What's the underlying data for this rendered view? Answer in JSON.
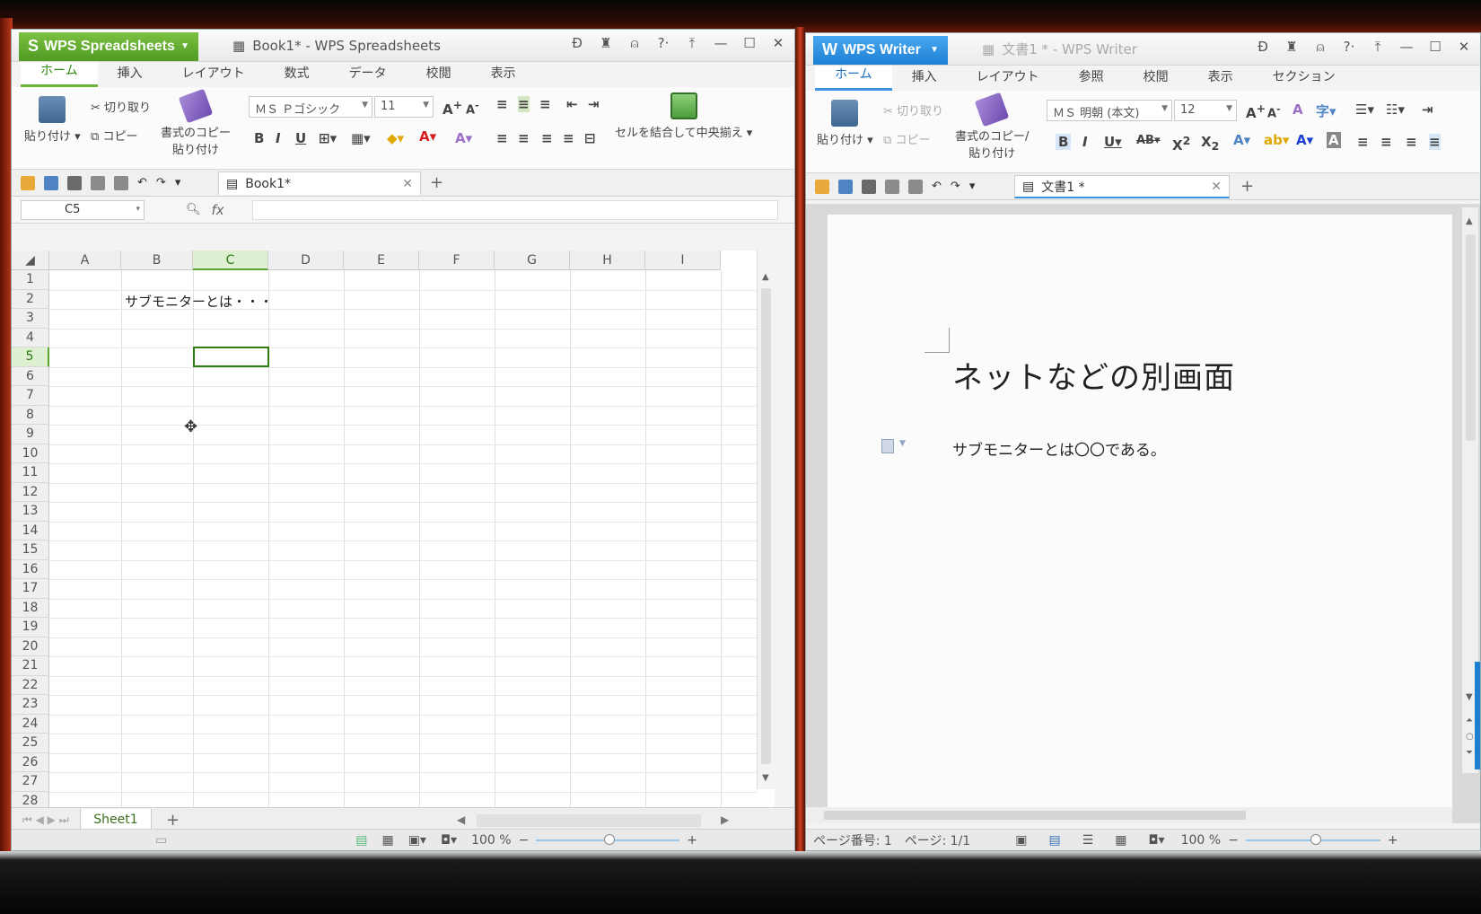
{
  "spreadsheet": {
    "app_name": "WPS Spreadsheets",
    "title": "Book1* - WPS Spreadsheets",
    "tabs": [
      "ホーム",
      "挿入",
      "レイアウト",
      "数式",
      "データ",
      "校閲",
      "表示"
    ],
    "ribbon": {
      "paste": "貼り付け",
      "cut": "切り取り",
      "copy": "コピー",
      "format_painter_line1": "書式のコピー",
      "format_painter_line2": "貼り付け",
      "font_name": "ＭＳ Ｐゴシック",
      "font_size": "11",
      "merge_center": "セルを結合して中央揃え"
    },
    "doc_tab": "Book1*",
    "name_box": "C5",
    "fx_label": "fx",
    "columns": [
      "A",
      "B",
      "C",
      "D",
      "E",
      "F",
      "G",
      "H",
      "I"
    ],
    "selected_column": "C",
    "selected_row": 5,
    "rows": [
      "1",
      "2",
      "3",
      "4",
      "5",
      "6",
      "7",
      "8",
      "9",
      "10",
      "11",
      "12",
      "13",
      "14",
      "15",
      "16",
      "17",
      "18",
      "19",
      "20",
      "21",
      "22",
      "23",
      "24",
      "25",
      "26",
      "27",
      "28"
    ],
    "cell_B2": "サブモニターとは・・・",
    "sheet_tab": "Sheet1",
    "zoom": "100 %"
  },
  "writer": {
    "app_name": "WPS Writer",
    "title": "文書1 * - WPS Writer",
    "tabs": [
      "ホーム",
      "挿入",
      "レイアウト",
      "参照",
      "校閲",
      "表示",
      "セクション"
    ],
    "ribbon": {
      "paste": "貼り付け",
      "cut": "切り取り",
      "copy": "コピー",
      "format_painter_line1": "書式のコピー/",
      "format_painter_line2": "貼り付け",
      "font_name": "ＭＳ 明朝 (本文)",
      "font_size": "12"
    },
    "doc_tab": "文書1 *",
    "heading": "ネットなどの別画面",
    "body": "サブモニターとは〇〇である。",
    "status_page_number": "ページ番号: 1",
    "status_pages": "ページ: 1/1",
    "zoom": "100 %"
  },
  "colors": {
    "wps_green": "#5fae2e",
    "wps_blue": "#2b8ee0",
    "selection_border": "#2f7d10"
  }
}
